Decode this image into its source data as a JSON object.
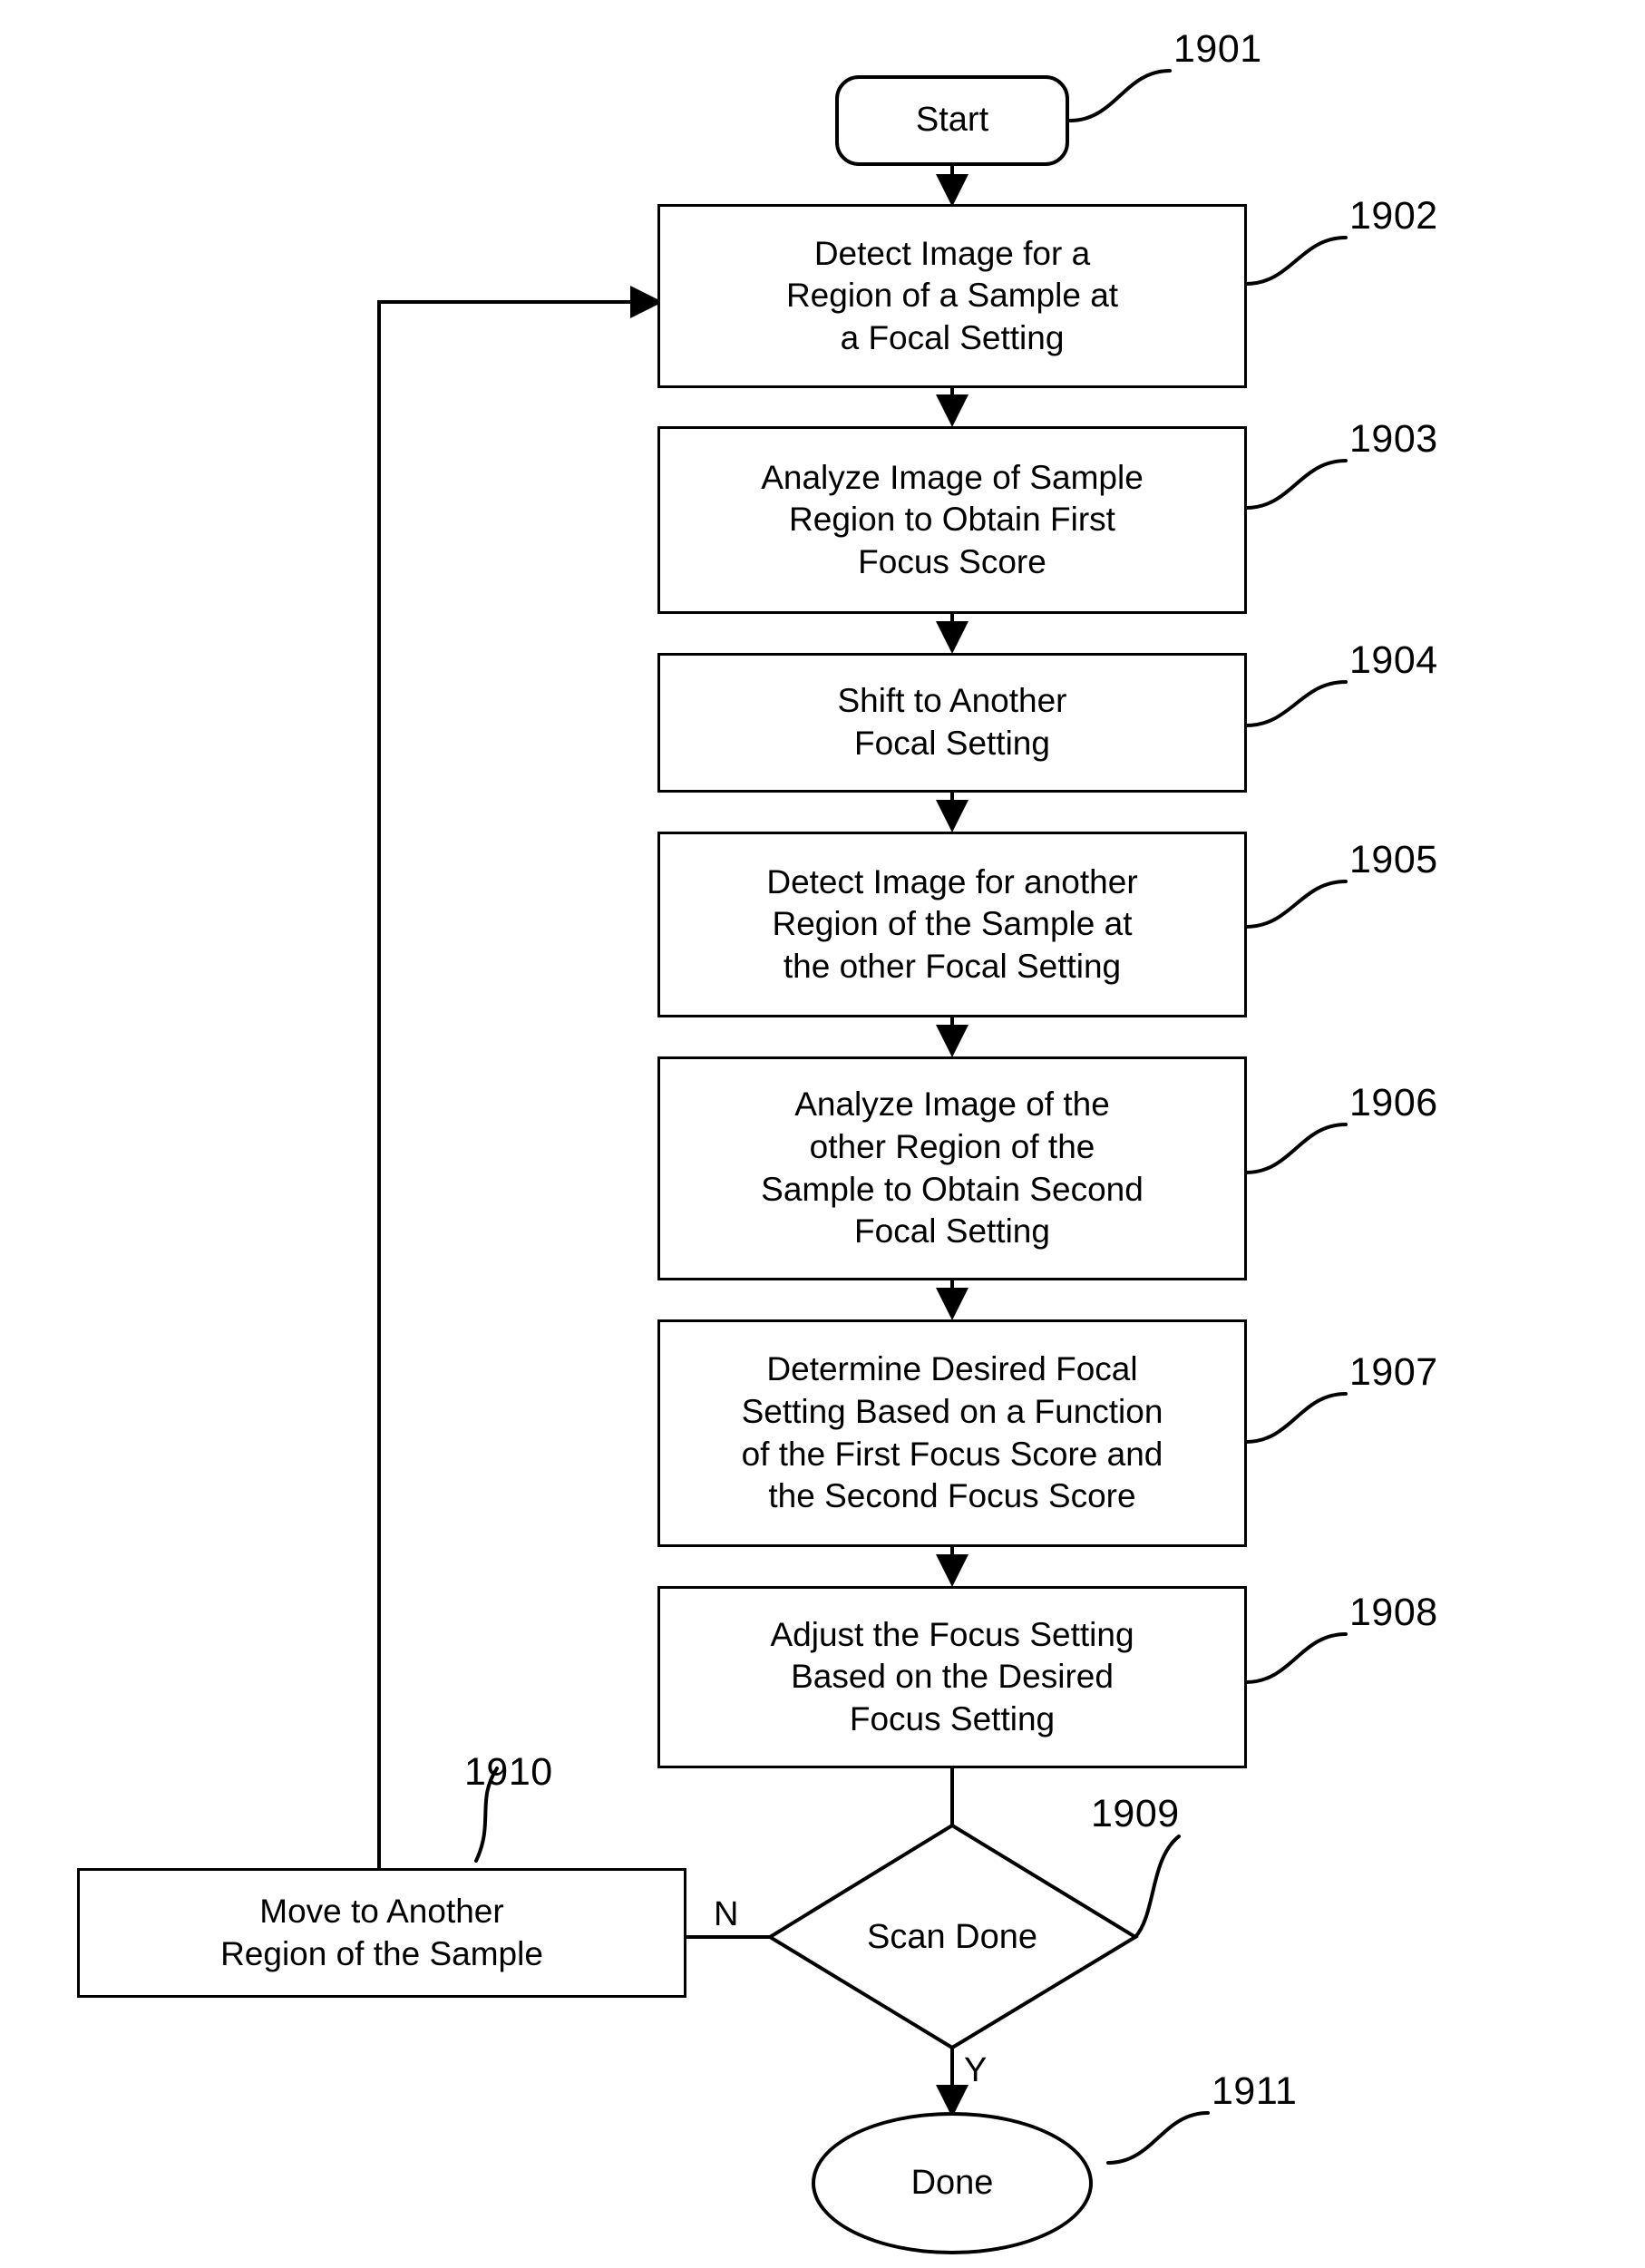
{
  "figure": {
    "title": "Autofocus scan flowchart",
    "line_color": "#000000",
    "background_color": "#ffffff"
  },
  "nodes": {
    "start": {
      "label": "Start",
      "ref": "1901",
      "shape": "rounded-terminator"
    },
    "detect_first": {
      "label": "Detect Image for a\nRegion of a Sample at\na Focal Setting",
      "ref": "1902",
      "shape": "process"
    },
    "analyze_first": {
      "label": "Analyze Image of Sample\nRegion to Obtain First\nFocus Score",
      "ref": "1903",
      "shape": "process"
    },
    "shift_focal": {
      "label": "Shift to Another\nFocal Setting",
      "ref": "1904",
      "shape": "process"
    },
    "detect_other": {
      "label": "Detect Image for another\nRegion of the Sample at\nthe other Focal Setting",
      "ref": "1905",
      "shape": "process"
    },
    "analyze_other": {
      "label": "Analyze Image of the\nother Region of the\nSample to Obtain Second\nFocal Setting",
      "ref": "1906",
      "shape": "process"
    },
    "determine_desired": {
      "label": "Determine Desired Focal\nSetting Based on a Function\nof the First Focus Score and\nthe Second Focus Score",
      "ref": "1907",
      "shape": "process"
    },
    "adjust_focus": {
      "label": "Adjust the Focus Setting\nBased on the Desired\nFocus Setting",
      "ref": "1908",
      "shape": "process"
    },
    "scan_done": {
      "label": "Scan Done",
      "ref": "1909",
      "shape": "decision"
    },
    "move_region": {
      "label": "Move to Another\nRegion of the Sample",
      "ref": "1910",
      "shape": "process"
    },
    "done": {
      "label": "Done",
      "ref": "1911",
      "shape": "ellipse-terminator"
    }
  },
  "branch_labels": {
    "no": "N",
    "yes": "Y"
  }
}
